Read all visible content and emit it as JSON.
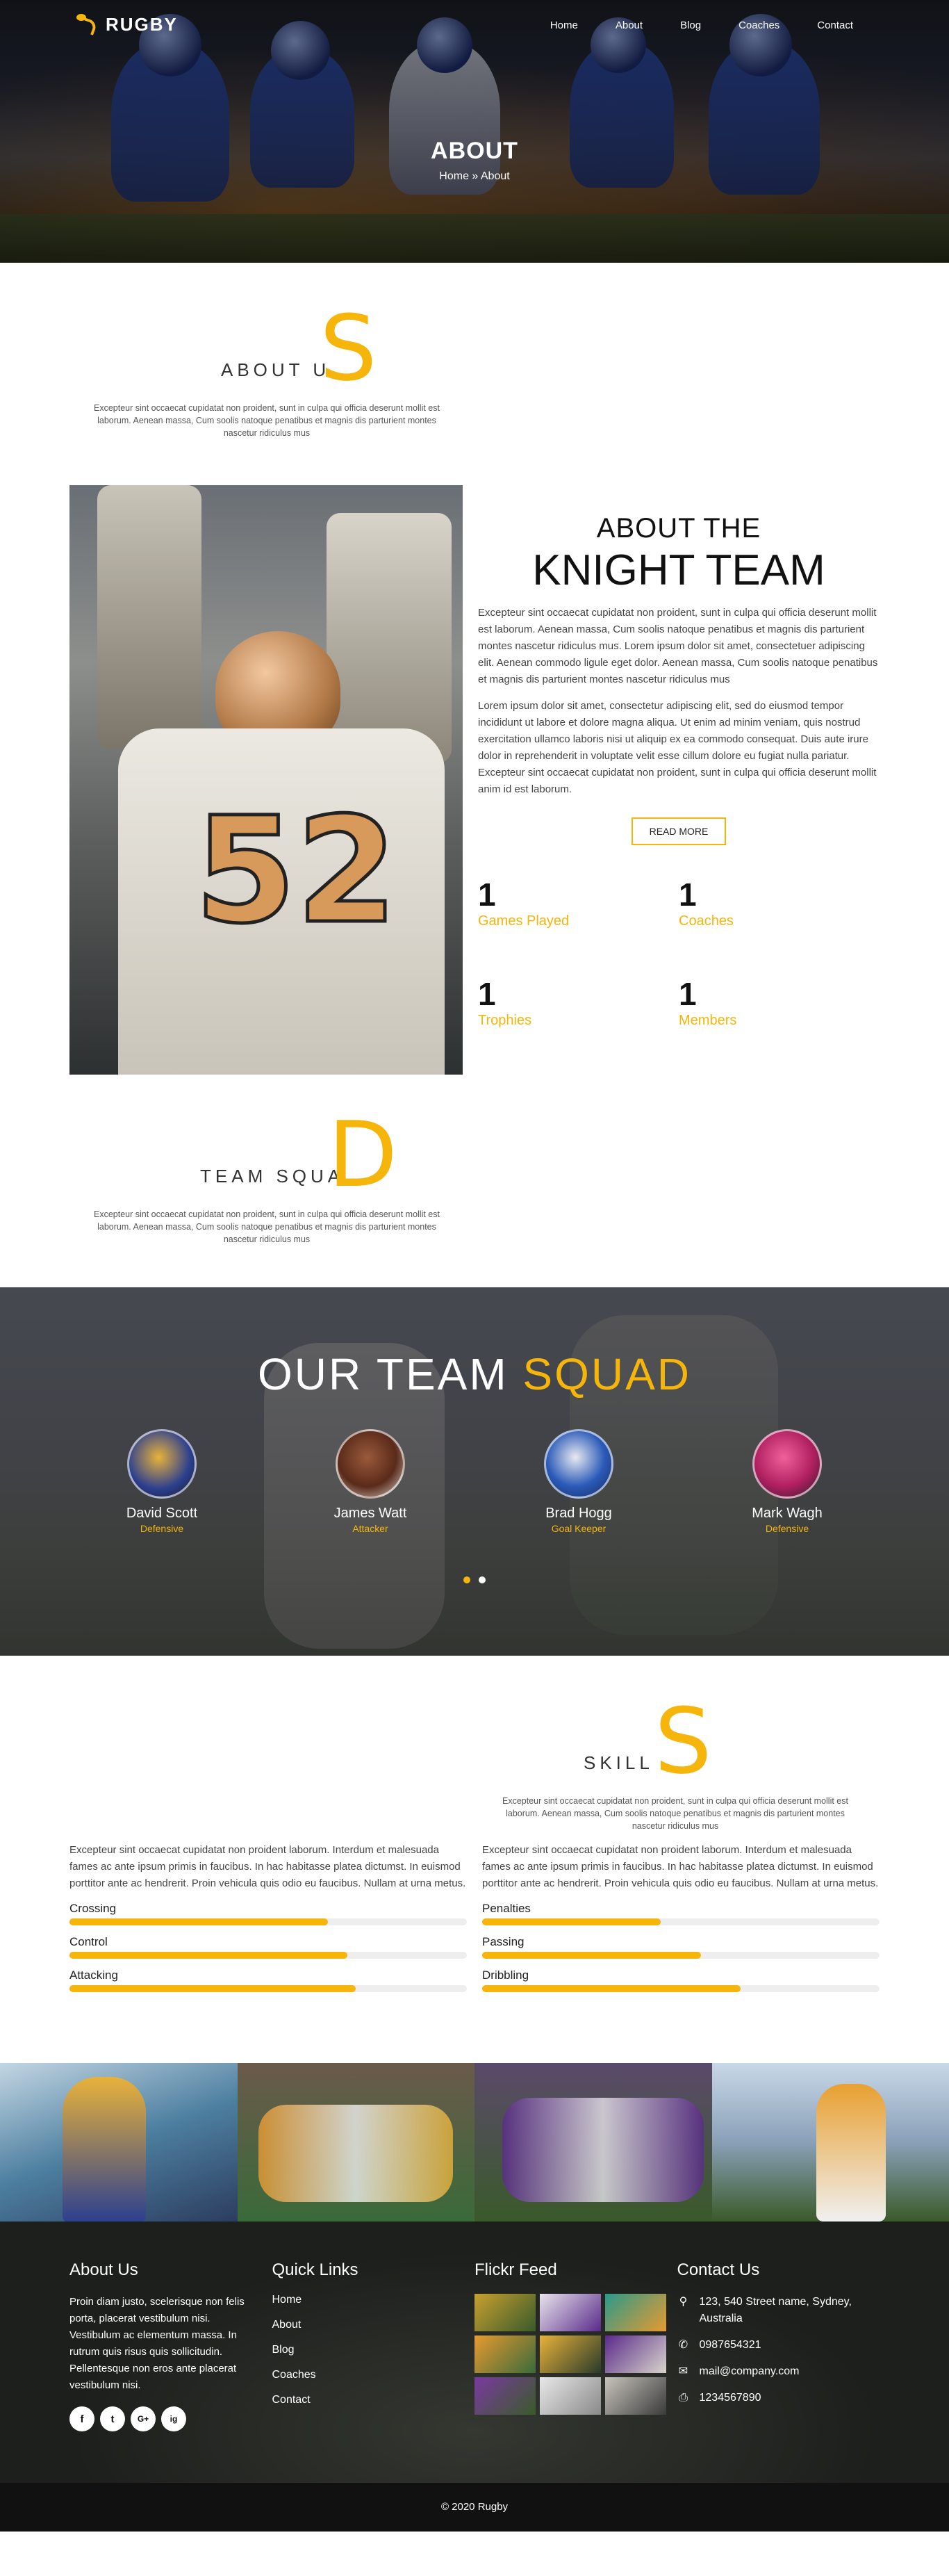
{
  "nav": {
    "brand": "RUGBY",
    "items": [
      "Home",
      "About",
      "Blog",
      "Coaches",
      "Contact"
    ]
  },
  "hero": {
    "title": "ABOUT",
    "breadcrumb": "Home » About"
  },
  "about_us": {
    "title_small": "ABOUT U",
    "title_big": "S",
    "description": "Excepteur sint occaecat cupidatat non proident, sunt in culpa qui officia deserunt mollit est laborum. Aenean massa, Cum soolis natoque penatibus et magnis dis parturient montes nascetur ridiculus mus"
  },
  "knight": {
    "heading_small": "ABOUT THE",
    "heading_big": "KNIGHT TEAM",
    "para1": "Excepteur sint occaecat cupidatat non proident, sunt in culpa qui officia deserunt mollit est laborum. Aenean massa, Cum soolis natoque penatibus et magnis dis parturient montes nascetur ridiculus mus. Lorem ipsum dolor sit amet, consectetuer adipiscing elit. Aenean commodo ligule eget dolor. Aenean massa, Cum soolis natoque penatibus et magnis dis parturient montes nascetur ridiculus mus",
    "para2": "Lorem ipsum dolor sit amet, consectetur adipiscing elit, sed do eiusmod tempor incididunt ut labore et dolore magna aliqua. Ut enim ad minim veniam, quis nostrud exercitation ullamco laboris nisi ut aliquip ex ea commodo consequat. Duis aute irure dolor in reprehenderit in voluptate velit esse cillum dolore eu fugiat nulla pariatur. Excepteur sint occaecat cupidatat non proident, sunt in culpa qui officia deserunt mollit anim id est laborum.",
    "read_more": "READ MORE",
    "jersey_number": "52",
    "stats": [
      {
        "num": "1",
        "label": "Games Played"
      },
      {
        "num": "1",
        "label": "Coaches"
      },
      {
        "num": "1",
        "label": "Trophies"
      },
      {
        "num": "1",
        "label": "Members"
      }
    ]
  },
  "team_squad": {
    "title_small": "TEAM SQUA",
    "title_big": "D",
    "description": "Excepteur sint occaecat cupidatat non proident, sunt in culpa qui officia deserunt mollit est laborum. Aenean massa, Cum soolis natoque penatibus et magnis dis parturient montes nascetur ridiculus mus"
  },
  "squad": {
    "heading_white": "OUR TEAM",
    "heading_accent": "SQUAD",
    "members": [
      {
        "name": "David Scott",
        "role": "Defensive"
      },
      {
        "name": "James Watt",
        "role": "Attacker"
      },
      {
        "name": "Brad Hogg",
        "role": "Goal Keeper"
      },
      {
        "name": "Mark Wagh",
        "role": "Defensive"
      }
    ]
  },
  "skills": {
    "title_small": "SKILL",
    "title_big": "S",
    "description": "Excepteur sint occaecat cupidatat non proident, sunt in culpa qui officia deserunt mollit est laborum. Aenean massa, Cum soolis natoque penatibus et magnis dis parturient montes nascetur ridiculus mus",
    "left_text": "Excepteur sint occaecat cupidatat non proident laborum. Interdum et malesuada fames ac ante ipsum primis in faucibus. In hac habitasse platea dictumst. In euismod porttitor ante ac hendrerit. Proin vehicula quis odio eu faucibus. Nullam at urna metus.",
    "right_text": "Excepteur sint occaecat cupidatat non proident laborum. Interdum et malesuada fames ac ante ipsum primis in faucibus. In hac habitasse platea dictumst. In euismod porttitor ante ac hendrerit. Proin vehicula quis odio eu faucibus. Nullam at urna metus.",
    "left": [
      {
        "label": "Crossing",
        "percent": 65
      },
      {
        "label": "Control",
        "percent": 70
      },
      {
        "label": "Attacking",
        "percent": 72
      }
    ],
    "right": [
      {
        "label": "Penalties",
        "percent": 45
      },
      {
        "label": "Passing",
        "percent": 55
      },
      {
        "label": "Dribbling",
        "percent": 65
      }
    ]
  },
  "footer": {
    "about_title": "About Us",
    "about_text": "Proin diam justo, scelerisque non felis porta, placerat vestibulum nisi. Vestibulum ac elementum massa. In rutrum quis risus quis sollicitudin. Pellentesque non eros ante placerat vestibulum nisi.",
    "social": [
      "f",
      "t",
      "G+",
      "ig"
    ],
    "links_title": "Quick Links",
    "links": [
      "Home",
      "About",
      "Blog",
      "Coaches",
      "Contact"
    ],
    "flickr_title": "Flickr Feed",
    "contact_title": "Contact Us",
    "address": "123, 540 Street name, Sydney, Australia",
    "phone": "0987654321",
    "email": "mail@company.com",
    "fax": "1234567890",
    "copyright": "© 2020 Rugby"
  }
}
